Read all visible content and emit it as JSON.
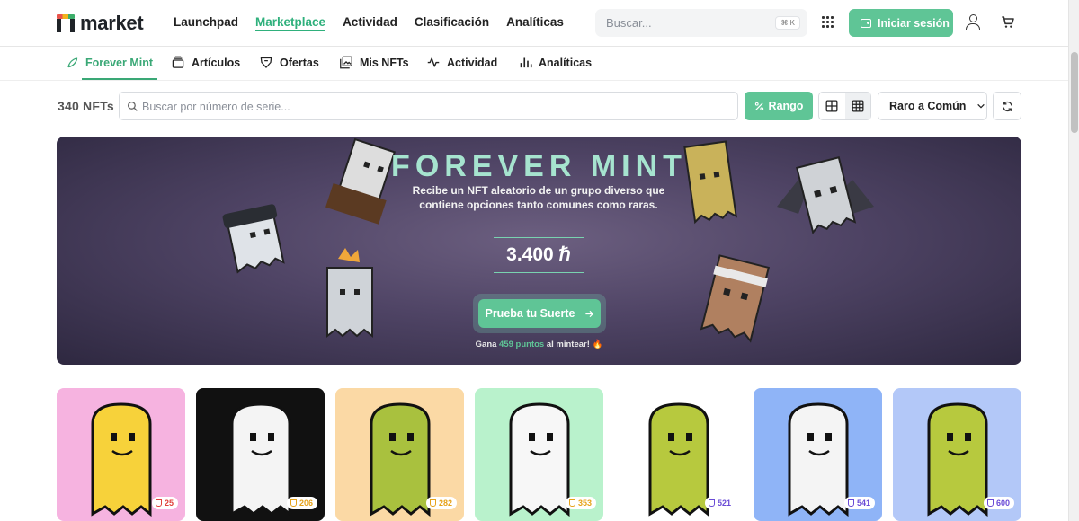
{
  "brand": {
    "name": "market"
  },
  "nav": {
    "items": [
      "Launchpad",
      "Marketplace",
      "Actividad",
      "Clasificación",
      "Analíticas"
    ],
    "active": "Marketplace"
  },
  "search": {
    "placeholder": "Buscar...",
    "shortcut": "⌘ K"
  },
  "header": {
    "login_label": "Iniciar sesión"
  },
  "subnav": {
    "items": [
      "Forever Mint",
      "Artículos",
      "Ofertas",
      "Mis NFTs",
      "Actividad",
      "Analíticas"
    ],
    "active": "Forever Mint"
  },
  "filters": {
    "count": "340 NFTs",
    "serial_placeholder": "Buscar por número de serie...",
    "range_label": "Rango",
    "sort_label": "Raro a Común"
  },
  "banner": {
    "title": "FOREVER MINT",
    "description": "Recibe un NFT aleatorio de un grupo diverso que contiene opciones tanto comunes como raras.",
    "price": "3.400 ℏ",
    "cta": "Prueba tu Suerte",
    "earn_prefix": "Gana",
    "earn_points": "459 puntos",
    "earn_suffix": "al mintear! 🔥"
  },
  "cards": [
    {
      "rank": "25",
      "bg": "#f6b3e0",
      "color": "#f7d23a",
      "badge_color": "#e0413b"
    },
    {
      "rank": "206",
      "bg": "#111111",
      "color": "#f4f4f4",
      "badge_color": "#e6a21a"
    },
    {
      "rank": "282",
      "bg": "#fbd9a5",
      "color": "#a9c13e",
      "badge_color": "#e6a21a"
    },
    {
      "rank": "353",
      "bg": "#b9f2cc",
      "color": "#f7f7f7",
      "badge_color": "#e6a21a"
    },
    {
      "rank": "521",
      "bg": "#ffffff",
      "color": "#b7c93e",
      "badge_color": "#6a4bd6"
    },
    {
      "rank": "541",
      "bg": "#8fb4f7",
      "color": "#f4f4f4",
      "badge_color": "#6a4bd6"
    },
    {
      "rank": "600",
      "bg": "#b3c8f8",
      "color": "#b7c93e",
      "badge_color": "#6a4bd6"
    }
  ],
  "colors": {
    "accent": "#5fc596",
    "banner_title": "#a6e4cf"
  }
}
